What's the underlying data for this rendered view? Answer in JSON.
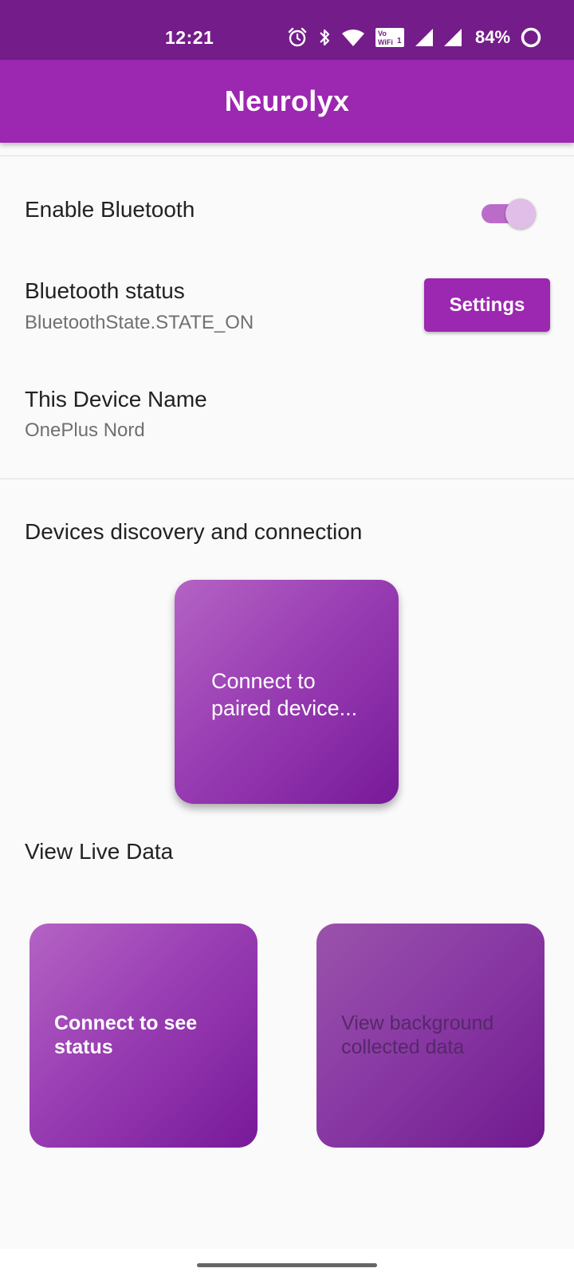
{
  "status_bar": {
    "time": "12:21",
    "battery": "84%",
    "icons": [
      "alarm-icon",
      "bluetooth-icon",
      "wifi-icon",
      "vowifi-icon",
      "signal-icon",
      "signal-icon",
      "battery-ring-icon"
    ],
    "vowifi_text": "Vo WiFi"
  },
  "app_bar": {
    "title": "Neurolyx",
    "color": "#9c27b0"
  },
  "bluetooth": {
    "enable_label": "Enable Bluetooth",
    "enabled": true,
    "status_label": "Bluetooth status",
    "status_value": "BluetoothState.STATE_ON",
    "settings_button": "Settings",
    "device_name_label": "This Device Name",
    "device_name_value": "OnePlus Nord"
  },
  "discovery": {
    "title": "Devices discovery and connection",
    "connect_tile_label": "Connect to paired device..."
  },
  "live_data": {
    "title": "View Live Data",
    "status_tile_label": "Connect to see status",
    "background_tile_label": "View background collected data"
  },
  "colors": {
    "primary": "#9c27b0",
    "status_bar": "#741c8a",
    "background": "#fafafa"
  }
}
